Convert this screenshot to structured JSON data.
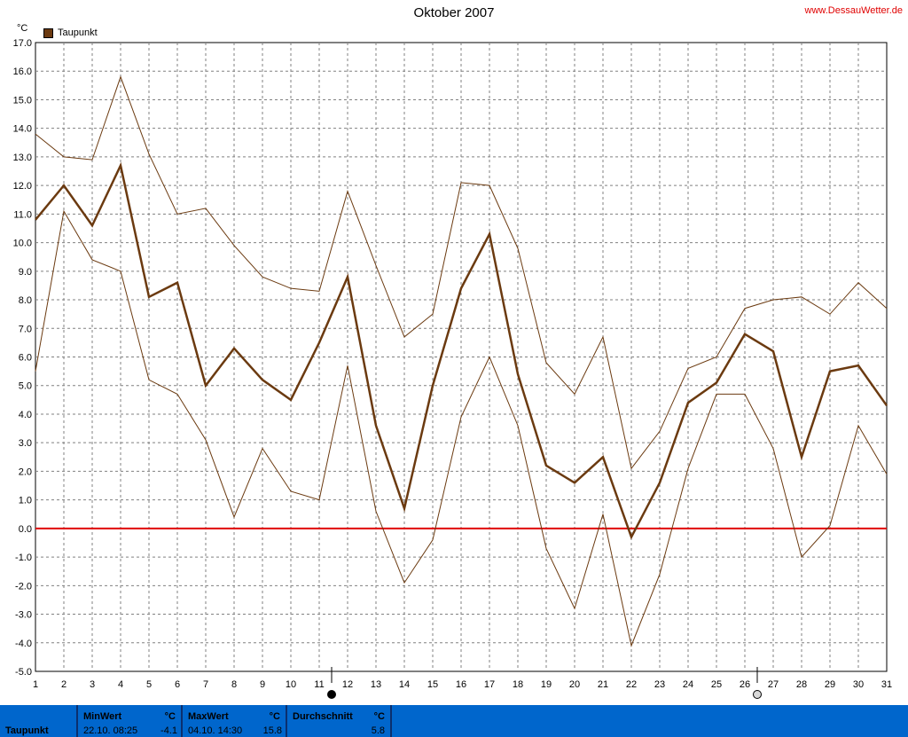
{
  "header": {
    "title": "Oktober 2007",
    "site": "www.DessauWetter.de",
    "unit": "°C"
  },
  "legend": {
    "label": "Taupunkt"
  },
  "colors": {
    "series": "#6b3a10",
    "zero_line": "#e00000",
    "grid": "#808080",
    "footer": "#0066cc"
  },
  "icons": {
    "moon_day_11": "full-moon-icon",
    "moon_day_26": "new-moon-icon"
  },
  "chart_data": {
    "type": "line",
    "title": "Oktober 2007",
    "xlabel": "",
    "ylabel": "°C",
    "x": [
      1,
      2,
      3,
      4,
      5,
      6,
      7,
      8,
      9,
      10,
      11,
      12,
      13,
      14,
      15,
      16,
      17,
      18,
      19,
      20,
      21,
      22,
      23,
      24,
      25,
      26,
      27,
      28,
      29,
      30,
      31
    ],
    "ylim": [
      -5.0,
      17.0
    ],
    "xlim": [
      1,
      31
    ],
    "y_ticks": [
      "17.0",
      "16.0",
      "15.0",
      "14.0",
      "13.0",
      "12.0",
      "11.0",
      "10.0",
      "9.0",
      "8.0",
      "7.0",
      "6.0",
      "5.0",
      "4.0",
      "3.0",
      "2.0",
      "1.0",
      "0.0",
      "-1.0",
      "-2.0",
      "-3.0",
      "-4.0",
      "-5.0"
    ],
    "x_ticks": [
      "1",
      "2",
      "3",
      "4",
      "5",
      "6",
      "7",
      "8",
      "9",
      "10",
      "11",
      "12",
      "13",
      "14",
      "15",
      "16",
      "17",
      "18",
      "19",
      "20",
      "21",
      "22",
      "23",
      "24",
      "25",
      "26",
      "27",
      "28",
      "29",
      "30",
      "31"
    ],
    "grid": true,
    "legend_position": "top-left",
    "series": [
      {
        "name": "Taupunkt",
        "role": "mean",
        "values": [
          10.8,
          12.0,
          10.6,
          12.7,
          8.1,
          8.6,
          5.0,
          6.3,
          5.2,
          4.5,
          6.5,
          8.8,
          3.6,
          0.7,
          5.0,
          8.4,
          10.3,
          5.4,
          2.2,
          1.6,
          2.5,
          -0.3,
          1.6,
          4.4,
          5.1,
          6.8,
          6.2,
          2.5,
          5.5,
          5.7,
          4.3
        ]
      },
      {
        "role": "max",
        "values": [
          13.8,
          13.0,
          12.9,
          15.8,
          13.1,
          11.0,
          11.2,
          9.9,
          8.8,
          8.4,
          8.3,
          11.8,
          9.2,
          6.7,
          7.5,
          12.1,
          12.0,
          9.8,
          5.8,
          4.7,
          6.7,
          2.1,
          3.4,
          5.6,
          6.0,
          7.7,
          8.0,
          8.1,
          7.5,
          8.6,
          7.7
        ]
      },
      {
        "role": "min",
        "values": [
          5.5,
          11.1,
          9.4,
          9.0,
          5.2,
          4.7,
          3.1,
          0.4,
          2.8,
          1.3,
          1.0,
          5.7,
          0.6,
          -1.9,
          -0.4,
          3.9,
          6.0,
          3.6,
          -0.7,
          -2.8,
          0.5,
          -4.1,
          -1.6,
          2.1,
          4.7,
          4.7,
          2.8,
          -1.0,
          0.1,
          3.6,
          1.9
        ]
      }
    ],
    "reference_line": {
      "y": 0.0
    },
    "moon_markers": [
      {
        "day": 11,
        "phase": "full"
      },
      {
        "day": 26,
        "phase": "new"
      }
    ]
  },
  "footer": {
    "row_label": "Taupunkt",
    "min": {
      "header": "MinWert",
      "unit": "°C",
      "when": "22.10.  08:25",
      "value": "-4.1"
    },
    "max": {
      "header": "MaxWert",
      "unit": "°C",
      "when": "04.10.  14:30",
      "value": "15.8"
    },
    "avg": {
      "header": "Durchschnitt",
      "unit": "°C",
      "value": "5.8"
    }
  }
}
